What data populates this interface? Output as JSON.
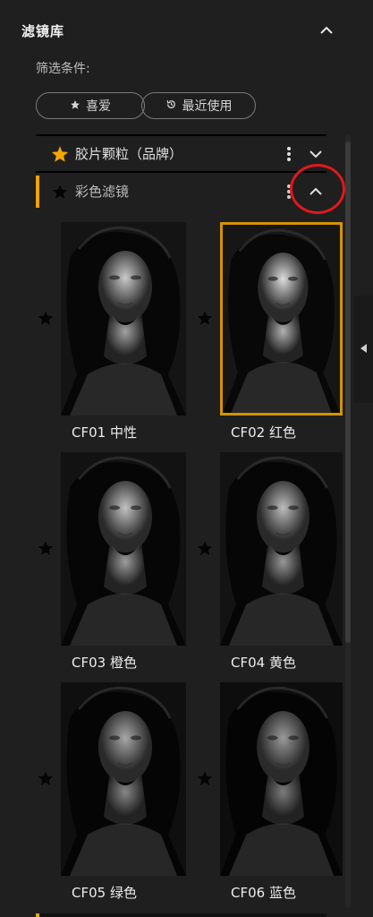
{
  "panel": {
    "title": "滤镜库",
    "filter_label": "筛选条件:",
    "filters": [
      {
        "label": "喜爱",
        "icon": "star-icon"
      },
      {
        "label": "最近使用",
        "icon": "history-icon"
      }
    ]
  },
  "categories": [
    {
      "label": "胶片颗粒（品牌）",
      "favorite": true,
      "expanded": false
    },
    {
      "label": "彩色滤镜",
      "favorite": false,
      "expanded": true,
      "active": true
    }
  ],
  "presets": [
    {
      "caption": "CF01 中性",
      "selected": false
    },
    {
      "caption": "CF02 红色",
      "selected": true
    },
    {
      "caption": "CF03 橙色",
      "selected": false
    },
    {
      "caption": "CF04 黄色",
      "selected": false
    },
    {
      "caption": "CF05 绿色",
      "selected": false
    },
    {
      "caption": "CF06 蓝色",
      "selected": false
    }
  ],
  "colors": {
    "accent": "#f0a400",
    "background": "#1f1f1f",
    "annotation_circle": "#e0181d",
    "favorite_star": "#f5a700"
  }
}
